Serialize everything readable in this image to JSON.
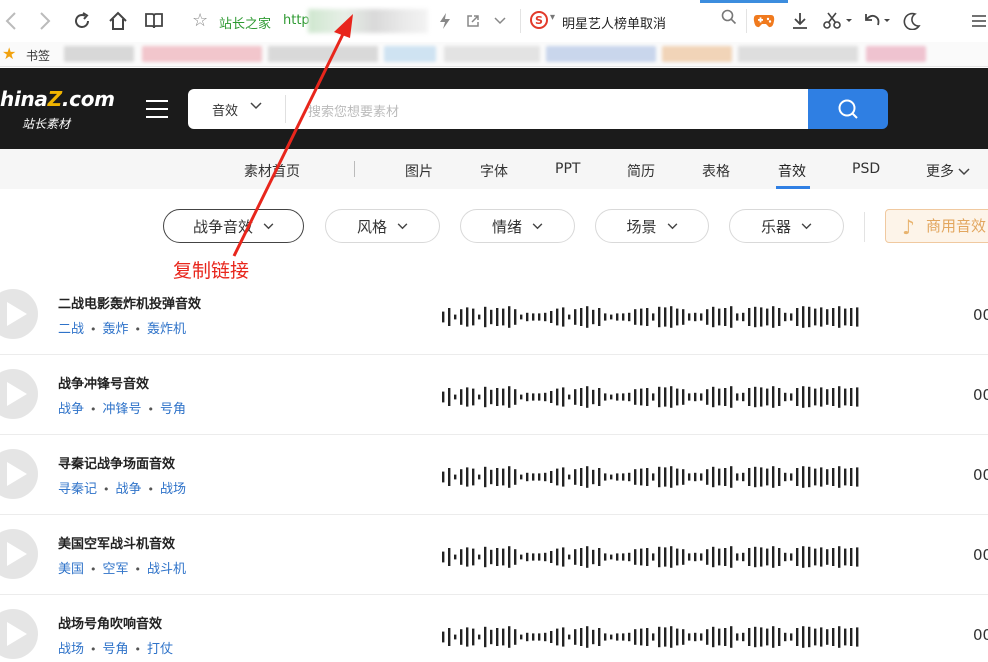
{
  "browser": {
    "address": {
      "site_name": "站长之家",
      "url_prefix": "http"
    },
    "search": {
      "engine_glyph": "S",
      "query": "明星艺人榜单取消"
    },
    "bookmarks_label": "书签"
  },
  "site": {
    "logo_text": "hina",
    "logo_z": "Z",
    "logo_domain": ".com",
    "logo_sub": "站长素材",
    "search_category": "音效",
    "search_placeholder": "搜索您想要素材"
  },
  "nav": {
    "items": [
      {
        "label": "素材首页"
      },
      {
        "label": "图片"
      },
      {
        "label": "字体"
      },
      {
        "label": "PPT"
      },
      {
        "label": "简历"
      },
      {
        "label": "表格"
      },
      {
        "label": "音效"
      },
      {
        "label": "PSD"
      },
      {
        "label": "更多"
      }
    ],
    "active": "音效"
  },
  "filters": {
    "items": [
      {
        "label": "战争音效"
      },
      {
        "label": "风格"
      },
      {
        "label": "情绪"
      },
      {
        "label": "场景"
      },
      {
        "label": "乐器"
      }
    ],
    "commercial_label": "商用音效"
  },
  "annotation": {
    "text": "复制链接",
    "color": "#e8261c"
  },
  "sounds": [
    {
      "title": "二战电影轰炸机投弹音效",
      "tags": [
        "二战",
        "轰炸",
        "轰炸机"
      ],
      "duration": "00"
    },
    {
      "title": "战争冲锋号音效",
      "tags": [
        "战争",
        "冲锋号",
        "号角"
      ],
      "duration": "00"
    },
    {
      "title": "寻秦记战争场面音效",
      "tags": [
        "寻秦记",
        "战争",
        "战场"
      ],
      "duration": "00"
    },
    {
      "title": "美国空军战斗机音效",
      "tags": [
        "美国",
        "空军",
        "战斗机"
      ],
      "duration": "00"
    },
    {
      "title": "战场号角吹响音效",
      "tags": [
        "战场",
        "号角",
        "打仗"
      ],
      "duration": "00"
    }
  ],
  "colors": {
    "accent": "#2f7fe3",
    "header_bg": "#1b1b1b",
    "tag": "#2f73c9",
    "annotation": "#e8261c"
  },
  "icons": {
    "toolbar": [
      "back-icon",
      "forward-icon",
      "reload-icon",
      "home-icon",
      "reader-icon",
      "star-icon",
      "flash-icon",
      "share-icon",
      "dropdown-icon",
      "search-icon",
      "game-icon",
      "download-icon",
      "cut-icon",
      "undo-icon",
      "night-icon",
      "menu-icon"
    ]
  }
}
